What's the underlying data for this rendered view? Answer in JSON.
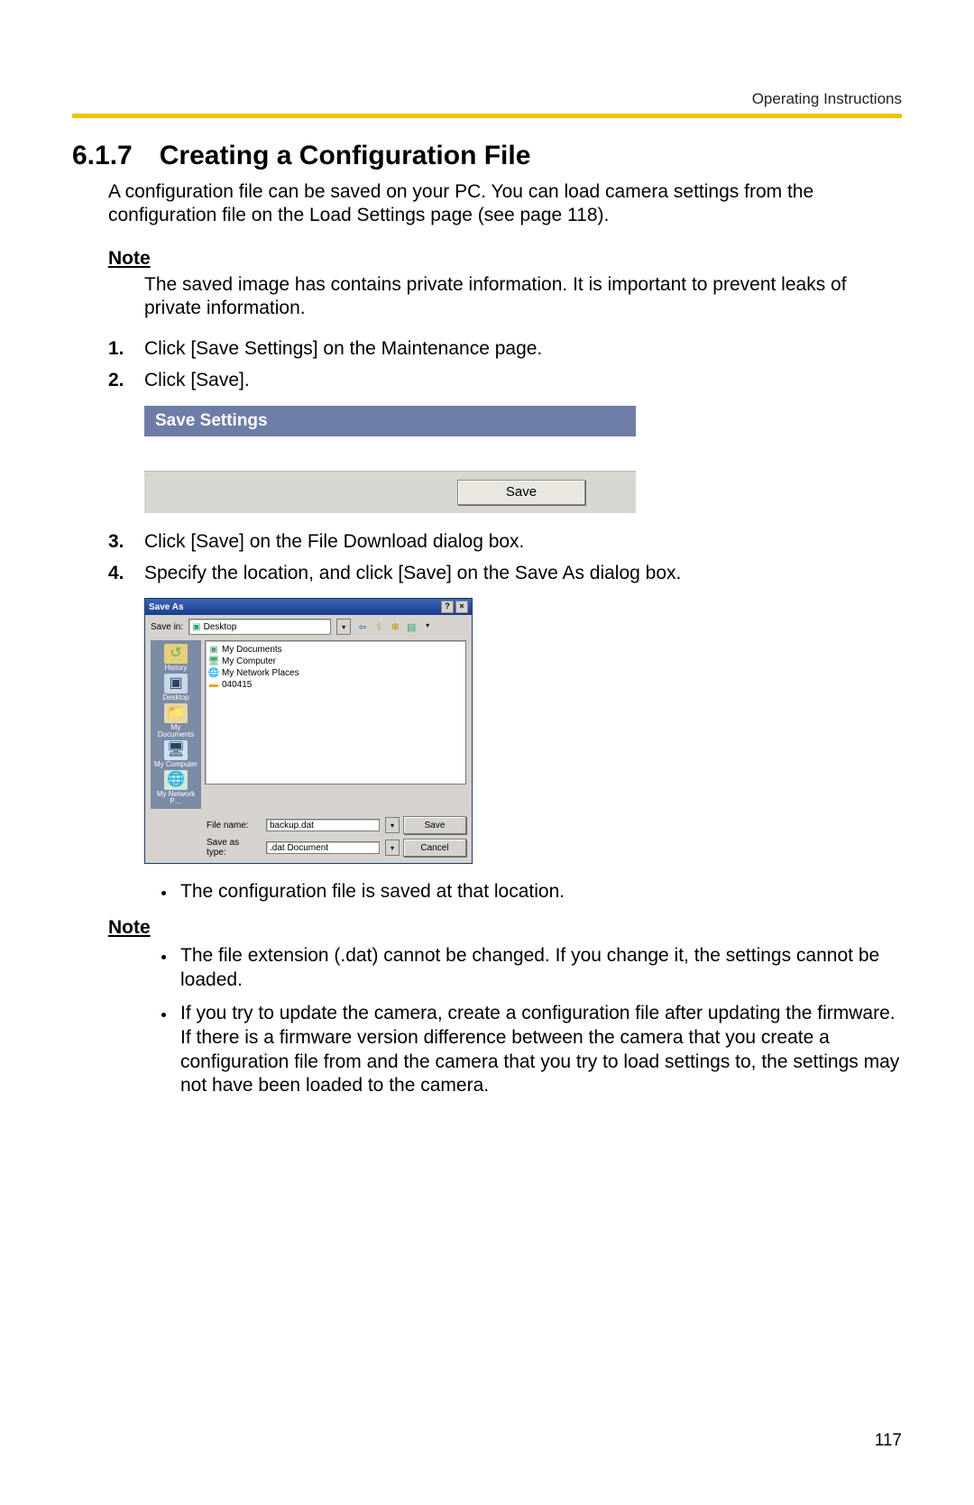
{
  "header": {
    "running": "Operating Instructions"
  },
  "section": {
    "number": "6.1.7",
    "title": "Creating a Configuration File"
  },
  "intro": "A configuration file can be saved on your PC. You can load camera settings from the configuration file on the Load Settings page (see page 118).",
  "note1": {
    "label": "Note",
    "body": "The saved image has contains private information. It is important to prevent leaks of private information."
  },
  "steps": {
    "s1": "Click [Save Settings] on the Maintenance page.",
    "s2": "Click [Save].",
    "s3": "Click [Save] on the File Download dialog box.",
    "s4": "Specify the location, and click [Save] on the Save As dialog box."
  },
  "savePanel": {
    "title": "Save Settings",
    "button": "Save"
  },
  "saveAs": {
    "title": "Save As",
    "saveInLabel": "Save in:",
    "saveInValue": "Desktop",
    "places": {
      "history": "History",
      "desktop": "Desktop",
      "mydocs": "My Documents",
      "mycomp": "My Computer",
      "network": "My Network P…"
    },
    "list": {
      "mydocs": "My Documents",
      "mycomp": "My Computer",
      "mynet": "My Network Places",
      "folder": "040415"
    },
    "fileNameLabel": "File name:",
    "fileNameValue": "backup.dat",
    "saveTypeLabel": "Save as type:",
    "saveTypeValue": ".dat Document",
    "saveBtn": "Save",
    "cancelBtn": "Cancel"
  },
  "bullet_config_saved": "The configuration file is saved at that location.",
  "note2": {
    "label": "Note",
    "b1": "The file extension (.dat) cannot be changed. If you change it, the settings cannot be loaded.",
    "b2": "If you try to update the camera, create a configuration file after updating the firmware. If there is a firmware version difference between the camera that you create a configuration file from and the camera that you try to load settings to, the settings may not have been loaded to the camera."
  },
  "pageNumber": "117"
}
